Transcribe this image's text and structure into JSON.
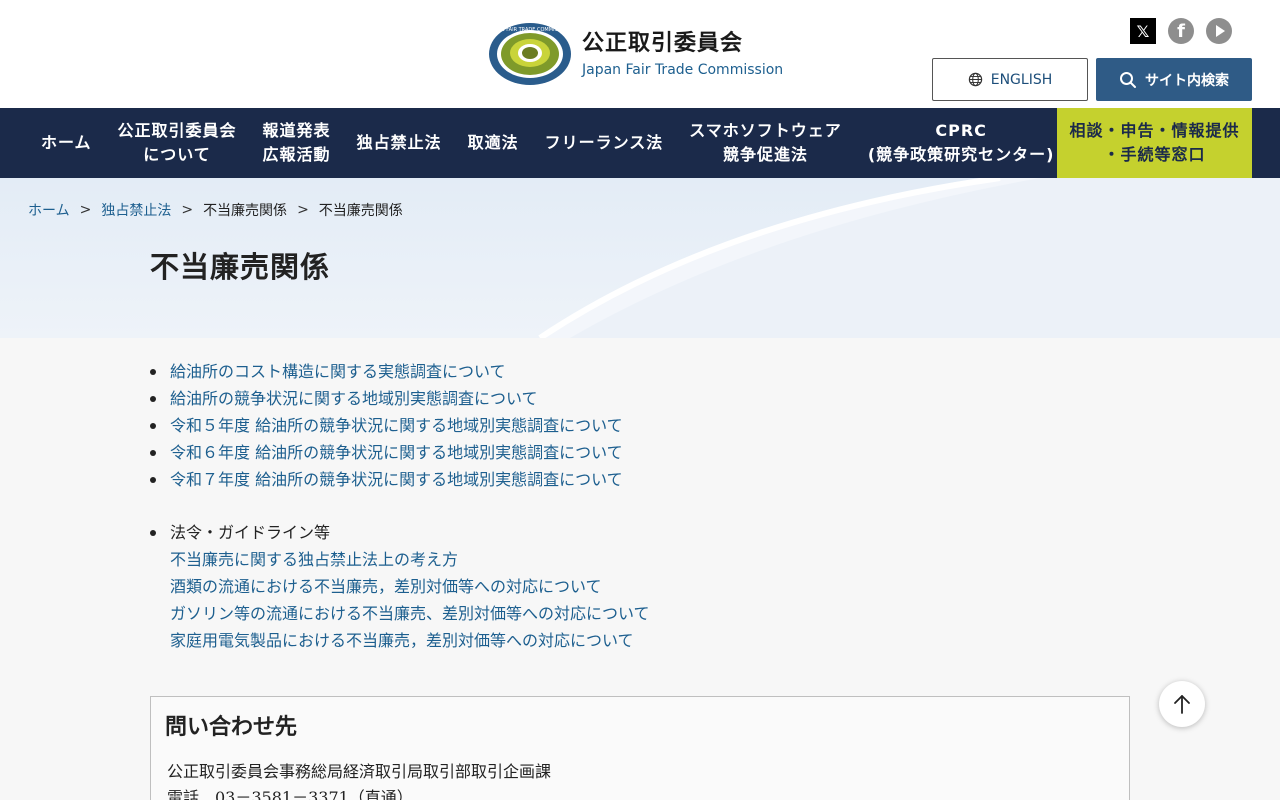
{
  "header": {
    "title": "公正取引委員会",
    "subtitle": "Japan Fair Trade Commission",
    "logo_ring_text": "JAPAN FAIR TRADE COMMISSION",
    "english_label": "ENGLISH",
    "search_label": "サイト内検索",
    "social": [
      "x-icon",
      "facebook-icon",
      "youtube-icon"
    ]
  },
  "nav": {
    "items": [
      "ホーム",
      "公正取引委員会\nについて",
      "報道発表\n広報活動",
      "独占禁止法",
      "取適法",
      "フリーランス法",
      "スマホソフトウェア\n競争促進法",
      "CPRC\n(競争政策研究センター)"
    ],
    "cta": "相談・申告・情報提供\n・手続等窓口"
  },
  "breadcrumb": {
    "items": [
      "ホーム",
      "独占禁止法",
      "不当廉売関係",
      "不当廉売関係"
    ],
    "separator": ">"
  },
  "page_title": "不当廉売関係",
  "links": [
    "給油所のコスト構造に関する実態調査について",
    "給油所の競争状況に関する地域別実態調査について",
    "令和５年度 給油所の競争状況に関する地域別実態調査について",
    "令和６年度 給油所の競争状況に関する地域別実態調査について",
    "令和７年度 給油所の競争状況に関する地域別実態調査について"
  ],
  "laws": {
    "heading": "法令・ガイドライン等",
    "items": [
      "不当廉売に関する独占禁止法上の考え方",
      "酒類の流通における不当廉売，差別対価等への対応について",
      "ガソリン等の流通における不当廉売、差別対価等への対応について",
      "家庭用電気製品における不当廉売，差別対価等への対応について"
    ]
  },
  "contact": {
    "title": "問い合わせ先",
    "department": "公正取引委員会事務総局経済取引局取引部取引企画課",
    "phone": "電話　03－3581－3371（直通）"
  },
  "colors": {
    "nav_bg": "#1b2a4a",
    "cta_bg": "#c5d12e",
    "search_bg": "#2f5b86",
    "link": "#1d5f8f"
  }
}
